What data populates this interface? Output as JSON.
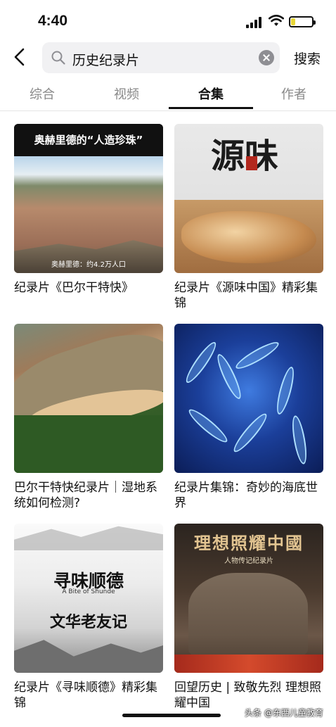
{
  "status_bar": {
    "time": "4:40"
  },
  "search": {
    "query": "历史纪录片",
    "submit_label": "搜索"
  },
  "tabs": [
    {
      "label": "综合"
    },
    {
      "label": "视频"
    },
    {
      "label": "合集"
    },
    {
      "label": "作者"
    }
  ],
  "active_tab": "合集",
  "results": [
    {
      "title": "纪录片《巴尔干特快》",
      "thumb_text": [
        "奥赫里德的“人造珍珠”",
        "奥赫里德：约4.2万人口"
      ]
    },
    {
      "title": "纪录片《源味中国》精彩集锦",
      "thumb_text": [
        "源味",
        "中国"
      ]
    },
    {
      "title": "巴尔干特快纪录片｜湿地系统如何检测?",
      "thumb_text": []
    },
    {
      "title": "纪录片集锦：奇妙的海底世界",
      "thumb_text": []
    },
    {
      "title": "纪录片《寻味顺德》精彩集锦",
      "thumb_text": [
        "寻味顺德",
        "A Bite of Shunde",
        "文华老友记"
      ]
    },
    {
      "title": "回望历史 | 致敬先烈 理想照耀中国",
      "thumb_text": [
        "理想照耀中國",
        "人物传记纪录片"
      ]
    }
  ],
  "watermark": "头条 @东西儿童教育",
  "colors": {
    "active_tab": "#111111",
    "inactive_tab": "#888888",
    "search_bg": "#f1f1f3",
    "battery_fill": "#e8d637"
  }
}
